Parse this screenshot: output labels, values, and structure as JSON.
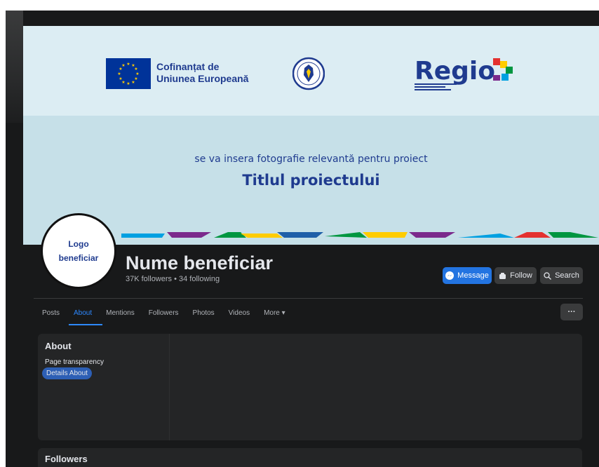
{
  "cover": {
    "eu_line1": "Cofinanțat de",
    "eu_line2": "Uniunea Europeană",
    "subtitle": "se va insera fotografie relevantă pentru proiect",
    "title": "Titlul proiectului",
    "regio_logo_text": "Regio",
    "colors": {
      "eu_blue": "#003399",
      "star_yellow": "#ffcc00",
      "text_blue": "#1f3b8f"
    }
  },
  "profile": {
    "logo_line1": "Logo",
    "logo_line2": "beneficiar",
    "name": "Nume beneficiar",
    "stats": "37K followers • 34 following"
  },
  "actions": {
    "message": "Message",
    "follow": "Follow",
    "search": "Search",
    "more": "···"
  },
  "tabs": [
    {
      "label": "Posts"
    },
    {
      "label": "About",
      "active": true
    },
    {
      "label": "Mentions"
    },
    {
      "label": "Followers"
    },
    {
      "label": "Photos"
    },
    {
      "label": "Videos"
    },
    {
      "label": "More ▾"
    }
  ],
  "about": {
    "title": "About",
    "link1": "Page transparency",
    "link2": "Details About"
  },
  "followers": {
    "title": "Followers"
  },
  "theme": {
    "bg": "#18191a",
    "card": "#242526",
    "accent": "#2374e1"
  }
}
